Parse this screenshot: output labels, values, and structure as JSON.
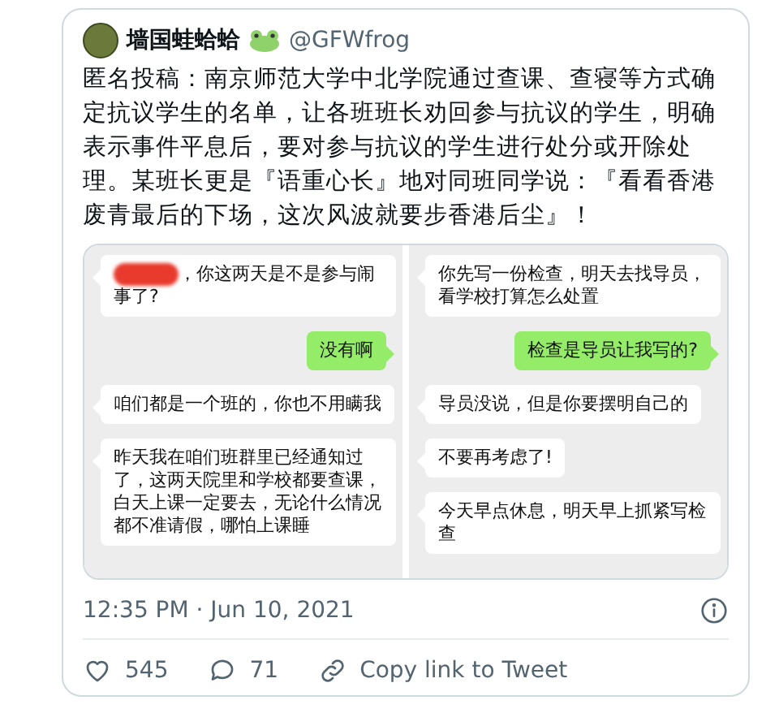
{
  "tweet": {
    "author": {
      "name": "墙国蛙蛤蛤",
      "handle": "@GFWfrog"
    },
    "text": "匿名投稿：南京师范大学中北学院通过查课、查寝等方式确定抗议学生的名单，让各班班长劝回参与抗议的学生，明确表示事件平息后，要对参与抗议的学生进行处分或开除处理。某班长更是『语重心长』地对同班同学说：『看看香港废青最后的下场，这次风波就要步香港后尘』！",
    "chats": [
      {
        "messages": [
          {
            "kind": "incoming",
            "redacted": true,
            "text": "，你这两天是不是参与闹事了?"
          },
          {
            "kind": "outgoing",
            "redacted": false,
            "text": "没有啊"
          },
          {
            "kind": "incoming",
            "redacted": false,
            "text": "咱们都是一个班的，你也不用瞒我"
          },
          {
            "kind": "incoming",
            "redacted": false,
            "text": "昨天我在咱们班群里已经通知过了，这两天院里和学校都要查课，白天上课一定要去，无论什么情况都不准请假，哪怕上课睡"
          }
        ]
      },
      {
        "messages": [
          {
            "kind": "incoming",
            "redacted": false,
            "text": "你先写一份检查，明天去找导员，看学校打算怎么处置"
          },
          {
            "kind": "outgoing",
            "redacted": false,
            "text": "检查是导员让我写的?"
          },
          {
            "kind": "incoming",
            "redacted": false,
            "text": "导员没说，但是你要摆明自己的"
          },
          {
            "kind": "incoming",
            "redacted": false,
            "text": "不要再考虑了!"
          },
          {
            "kind": "incoming",
            "redacted": false,
            "text": "今天早点休息，明天早上抓紧写检查"
          }
        ]
      }
    ],
    "timestamp": "12:35 PM · Jun 10, 2021",
    "likes": "545",
    "replies": "71",
    "copy_link": "Copy link to Tweet"
  }
}
